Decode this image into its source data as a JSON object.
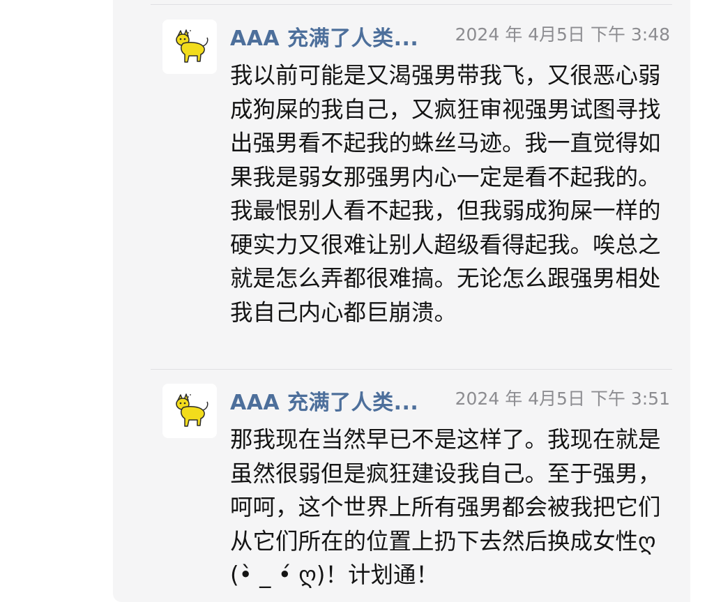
{
  "posts": [
    {
      "author": "AAA 充满了人类...",
      "timestamp": "2024 年 4月5日 下午 3:48",
      "text": "我以前可能是又渴强男带我飞，又很恶心弱成狗屎的我自己，又疯狂审视强男试图寻找出强男看不起我的蛛丝马迹。我一直觉得如果我是弱女那强男内心一定是看不起我的。我最恨别人看不起我，但我弱成狗屎一样的硬实力又很难让别人超级看得起我。唉总之就是怎么弄都很难搞。无论怎么跟强男相处我自己内心都巨崩溃。",
      "avatar_icon": "yellow-cat-icon"
    },
    {
      "author": "AAA 充满了人类...",
      "timestamp": "2024 年 4月5日 下午 3:51",
      "text": "那我现在当然早已不是这样了。我现在就是虽然很弱但是疯狂建设我自己。至于强男，呵呵，这个世界上所有强男都会被我把它们从它们所在的位置上扔下去然后换成女性ღ(•̀ _ •́ ღ)！计划通！",
      "avatar_icon": "yellow-cat-icon"
    }
  ],
  "colors": {
    "author": "#4d6f9b",
    "timestamp": "#8c8c90",
    "text": "#141414",
    "panel_bg": "#f5f5f6",
    "avatar_fill": "#f2dc1c"
  }
}
